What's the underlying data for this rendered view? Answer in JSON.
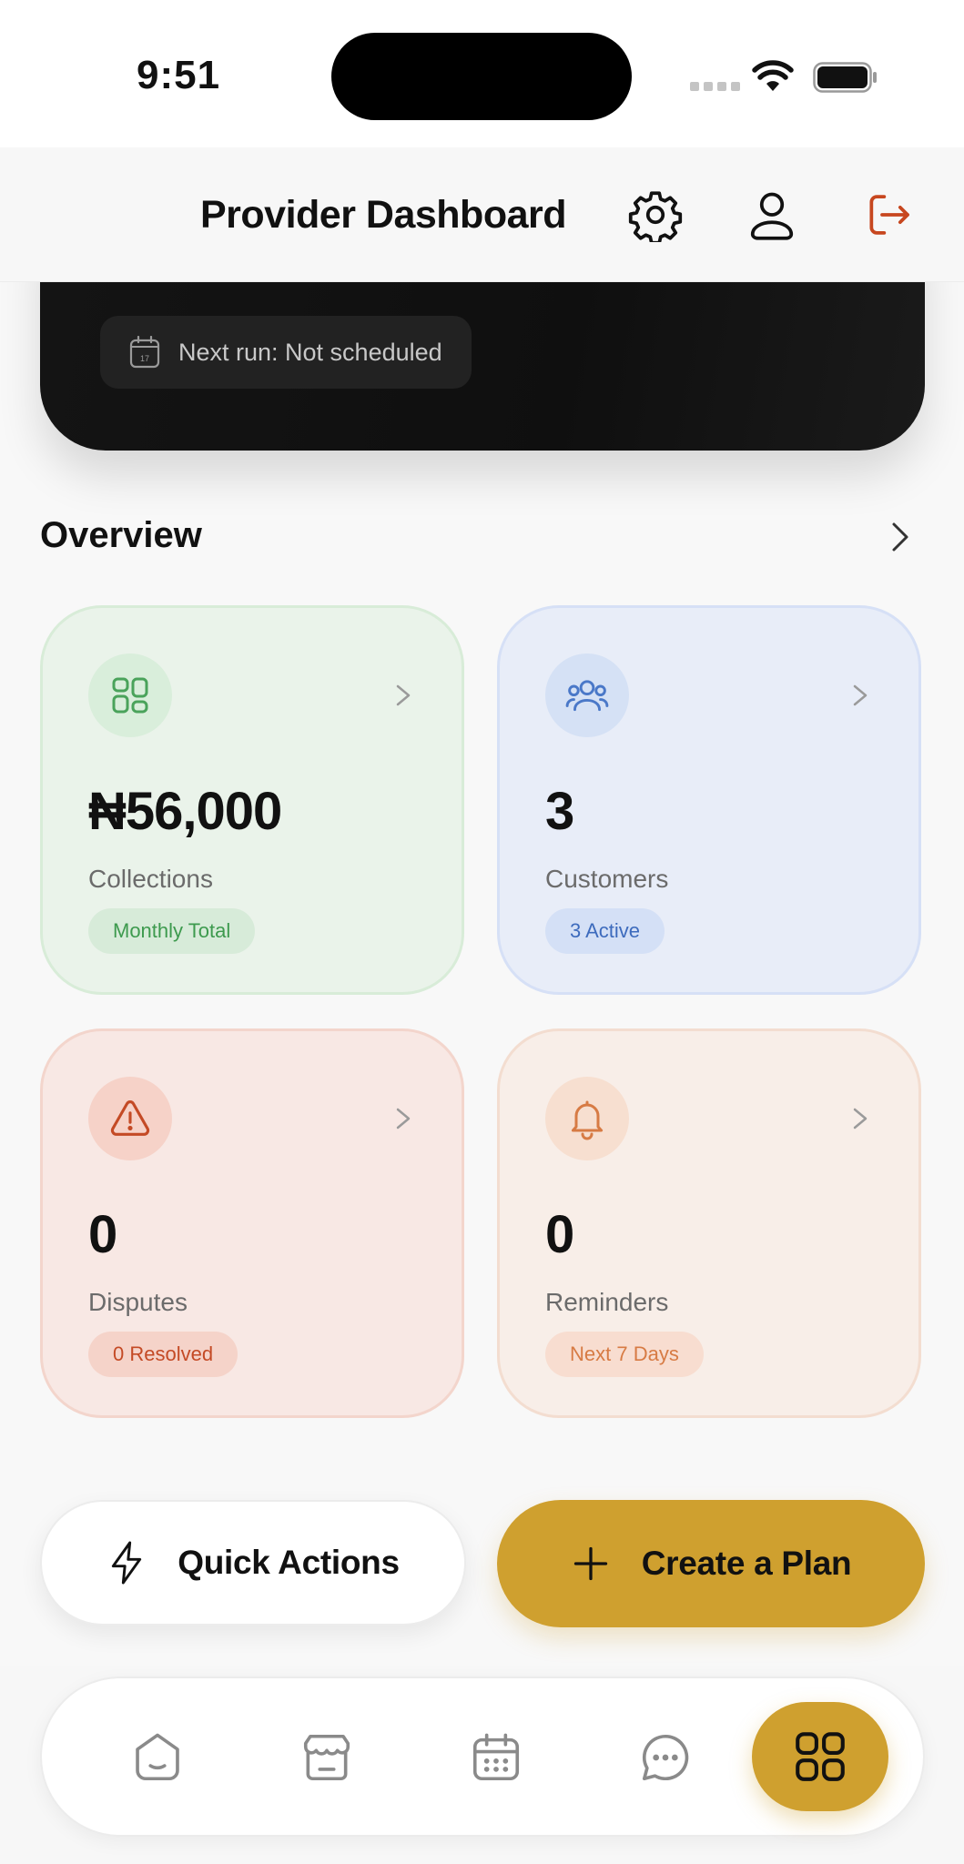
{
  "status_bar": {
    "time": "9:51"
  },
  "header": {
    "title": "Provider Dashboard",
    "icons": [
      "settings-gear-icon",
      "profile-icon",
      "logout-icon"
    ],
    "logout_color": "#c7471f"
  },
  "schedule": {
    "icon": "calendar-icon",
    "calendar_day": "17",
    "next_run": "Next run: Not scheduled"
  },
  "overview": {
    "title": "Overview",
    "cards": [
      {
        "id": "collections",
        "icon": "grid-icon",
        "value": "₦56,000",
        "label": "Collections",
        "badge": "Monthly Total",
        "accent": "#3d9a4e"
      },
      {
        "id": "customers",
        "icon": "users-icon",
        "value": "3",
        "label": "Customers",
        "badge": "3 Active",
        "accent": "#3d6bbd"
      },
      {
        "id": "disputes",
        "icon": "alert-triangle-icon",
        "value": "0",
        "label": "Disputes",
        "badge": "0 Resolved",
        "accent": "#c44a25"
      },
      {
        "id": "reminders",
        "icon": "bell-icon",
        "value": "0",
        "label": "Reminders",
        "badge": "Next 7 Days",
        "accent": "#d77b44"
      }
    ]
  },
  "actions": {
    "quick_actions": "Quick Actions",
    "create_plan": "Create a Plan",
    "primary_color": "#cfa02f"
  },
  "bottom_nav": {
    "items": [
      "home-icon",
      "store-icon",
      "calendar-icon",
      "chat-icon",
      "dashboard-icon"
    ],
    "active": "dashboard-icon"
  }
}
